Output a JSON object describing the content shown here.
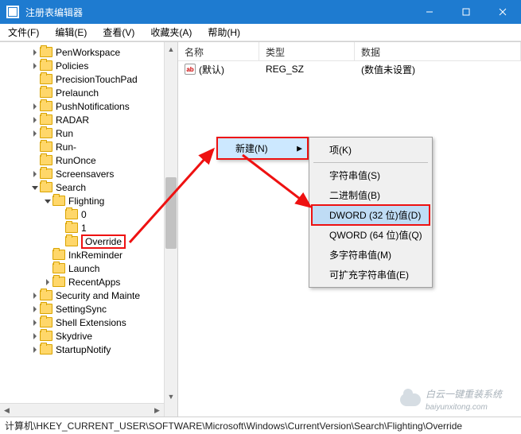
{
  "window": {
    "title": "注册表编辑器"
  },
  "menu": {
    "file": "文件(F)",
    "edit": "编辑(E)",
    "view": "查看(V)",
    "fav": "收藏夹(A)",
    "help": "帮助(H)"
  },
  "tree": {
    "items": [
      {
        "indent": 2,
        "exp": ">",
        "label": "PenWorkspace"
      },
      {
        "indent": 2,
        "exp": ">",
        "label": "Policies"
      },
      {
        "indent": 2,
        "exp": "",
        "label": "PrecisionTouchPad"
      },
      {
        "indent": 2,
        "exp": "",
        "label": "Prelaunch"
      },
      {
        "indent": 2,
        "exp": ">",
        "label": "PushNotifications"
      },
      {
        "indent": 2,
        "exp": ">",
        "label": "RADAR"
      },
      {
        "indent": 2,
        "exp": ">",
        "label": "Run"
      },
      {
        "indent": 2,
        "exp": "",
        "label": "Run-"
      },
      {
        "indent": 2,
        "exp": "",
        "label": "RunOnce"
      },
      {
        "indent": 2,
        "exp": ">",
        "label": "Screensavers"
      },
      {
        "indent": 2,
        "exp": "v",
        "label": "Search"
      },
      {
        "indent": 3,
        "exp": "v",
        "label": "Flighting"
      },
      {
        "indent": 4,
        "exp": "",
        "label": "0"
      },
      {
        "indent": 4,
        "exp": "",
        "label": "1"
      },
      {
        "indent": 4,
        "exp": "",
        "label": "Override",
        "hl": true
      },
      {
        "indent": 3,
        "exp": "",
        "label": "InkReminder"
      },
      {
        "indent": 3,
        "exp": "",
        "label": "Launch"
      },
      {
        "indent": 3,
        "exp": ">",
        "label": "RecentApps"
      },
      {
        "indent": 2,
        "exp": ">",
        "label": "Security and Mainte"
      },
      {
        "indent": 2,
        "exp": ">",
        "label": "SettingSync"
      },
      {
        "indent": 2,
        "exp": ">",
        "label": "Shell Extensions"
      },
      {
        "indent": 2,
        "exp": ">",
        "label": "Skydrive"
      },
      {
        "indent": 2,
        "exp": ">",
        "label": "StartupNotify"
      }
    ]
  },
  "list": {
    "columns": {
      "name": "名称",
      "type": "类型",
      "data": "数据"
    },
    "rows": [
      {
        "icon": "ab",
        "name": "(默认)",
        "type": "REG_SZ",
        "data": "(数值未设置)"
      }
    ]
  },
  "context1": {
    "new_item": "新建(N)"
  },
  "context2": {
    "key": "项(K)",
    "string": "字符串值(S)",
    "binary": "二进制值(B)",
    "dword": "DWORD (32 位)值(D)",
    "qword": "QWORD (64 位)值(Q)",
    "multi": "多字符串值(M)",
    "expand": "可扩充字符串值(E)"
  },
  "status": {
    "path": "计算机\\HKEY_CURRENT_USER\\SOFTWARE\\Microsoft\\Windows\\CurrentVersion\\Search\\Flighting\\Override"
  },
  "watermark": {
    "text": "白云一键重装系统",
    "url": "baiyunxitong.com"
  },
  "annotation": {
    "highlight_color": "#e11"
  }
}
